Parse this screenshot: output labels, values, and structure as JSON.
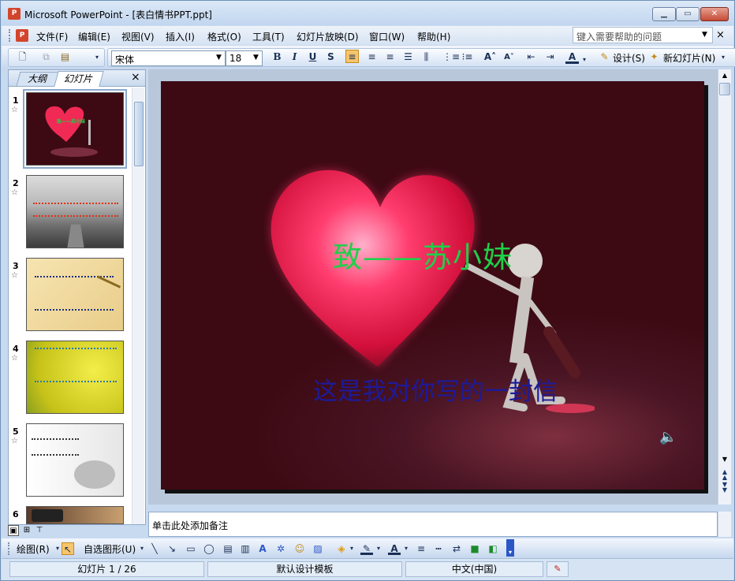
{
  "window": {
    "title": "Microsoft PowerPoint - [表白情书PPT.ppt]",
    "app_icon": "powerpoint-icon",
    "buttons": {
      "minimize": "▁",
      "maximize": "▭",
      "close": "✕"
    }
  },
  "menubar": {
    "items": [
      "文件(F)",
      "编辑(E)",
      "视图(V)",
      "插入(I)",
      "格式(O)",
      "工具(T)",
      "幻灯片放映(D)",
      "窗口(W)",
      "帮助(H)"
    ],
    "help_placeholder": "键入需要帮助的问题",
    "doc_close": "×"
  },
  "toolbar": {
    "font_name": "宋体",
    "font_size": "18",
    "bold": "B",
    "italic": "I",
    "underline": "U",
    "shadow": "S",
    "design_label": "设计(S)",
    "new_slide_label": "新幻灯片(N)"
  },
  "left_panel": {
    "tabs": [
      "大纲",
      "幻灯片"
    ],
    "close": "×",
    "slides": [
      {
        "num": "1",
        "text": "致——苏小妹"
      },
      {
        "num": "2",
        "text": ""
      },
      {
        "num": "3",
        "text": ""
      },
      {
        "num": "4",
        "text": ""
      },
      {
        "num": "5",
        "text": ""
      },
      {
        "num": "6",
        "text": ""
      }
    ]
  },
  "slide": {
    "title": "致——苏小妹",
    "subtitle": "这是我对你写的一封信",
    "sound_icon": "speaker-icon"
  },
  "notes": {
    "placeholder": "单击此处添加备注"
  },
  "drawbar": {
    "draw_label": "绘图(R)",
    "autoshapes_label": "自选图形(U)"
  },
  "status": {
    "slide_pos": "幻灯片 1 / 26",
    "template": "默认设计模板",
    "language": "中文(中国)"
  }
}
